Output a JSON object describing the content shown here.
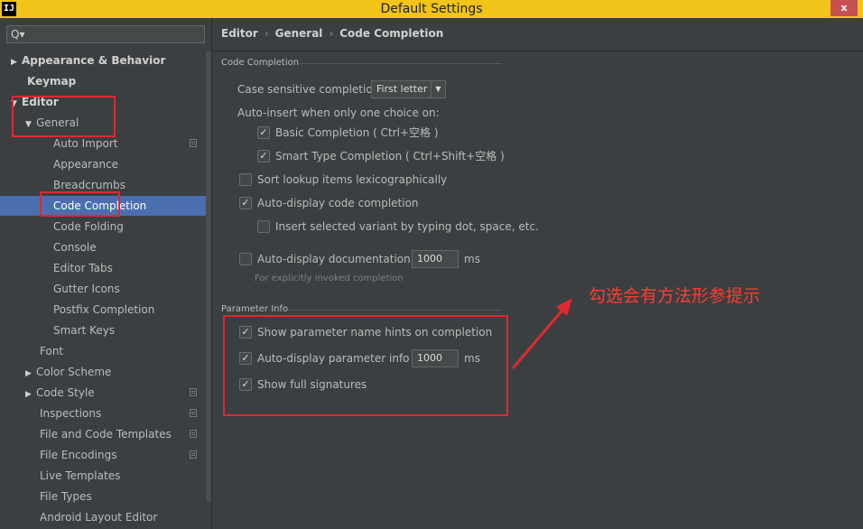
{
  "window": {
    "title": "Default Settings",
    "app_icon": "IJ",
    "close_symbol": "x"
  },
  "search": {
    "icon": "search-icon",
    "glyph": "Q▾"
  },
  "sidebar": {
    "items": [
      {
        "label": "Appearance & Behavior",
        "arrow": "▶",
        "bold": true
      },
      {
        "label": "Keymap",
        "bold": true
      },
      {
        "label": "Editor",
        "arrow": "▼",
        "bold": true
      },
      {
        "label": "General",
        "arrow": "▼"
      },
      {
        "label": "Auto Import"
      },
      {
        "label": "Appearance"
      },
      {
        "label": "Breadcrumbs"
      },
      {
        "label": "Code Completion",
        "selected": true
      },
      {
        "label": "Code Folding"
      },
      {
        "label": "Console"
      },
      {
        "label": "Editor Tabs"
      },
      {
        "label": "Gutter Icons"
      },
      {
        "label": "Postfix Completion"
      },
      {
        "label": "Smart Keys"
      },
      {
        "label": "Font"
      },
      {
        "label": "Color Scheme",
        "arrow": "▶"
      },
      {
        "label": "Code Style",
        "arrow": "▶"
      },
      {
        "label": "Inspections"
      },
      {
        "label": "File and Code Templates"
      },
      {
        "label": "File Encodings"
      },
      {
        "label": "Live Templates"
      },
      {
        "label": "File Types"
      },
      {
        "label": "Android Layout Editor"
      }
    ]
  },
  "breadcrumb": {
    "part1": "Editor",
    "part2": "General",
    "part3": "Code Completion",
    "sep": "›"
  },
  "code_completion": {
    "section_title": "Code Completion",
    "case_sensitive_label": "Case sensitive completion:",
    "case_sensitive_value": "First letter",
    "auto_insert_label": "Auto-insert when only one choice on:",
    "basic_completion": "Basic Completion ( Ctrl+空格 )",
    "smart_type_completion": "Smart Type Completion ( Ctrl+Shift+空格 )",
    "sort_lookup": "Sort lookup items lexicographically",
    "auto_display_code": "Auto-display code completion",
    "insert_selected": "Insert selected variant by typing dot, space, etc.",
    "auto_display_doc": "Auto-display documentation in",
    "doc_delay": "1000",
    "doc_unit": "ms",
    "doc_hint": "For explicitly invoked completion",
    "check": "✓"
  },
  "parameter_info": {
    "section_title": "Parameter Info",
    "show_name_hints": "Show parameter name hints on completion",
    "auto_display_param": "Auto-display parameter info in",
    "param_delay": "1000",
    "param_unit": "ms",
    "show_full_signatures": "Show full signatures"
  },
  "annotation": {
    "text": "勾选会有方法形参提示"
  },
  "colors": {
    "titlebar": "#f0c418",
    "selection": "#4b6eaf",
    "annotation_red": "#e0292f"
  }
}
